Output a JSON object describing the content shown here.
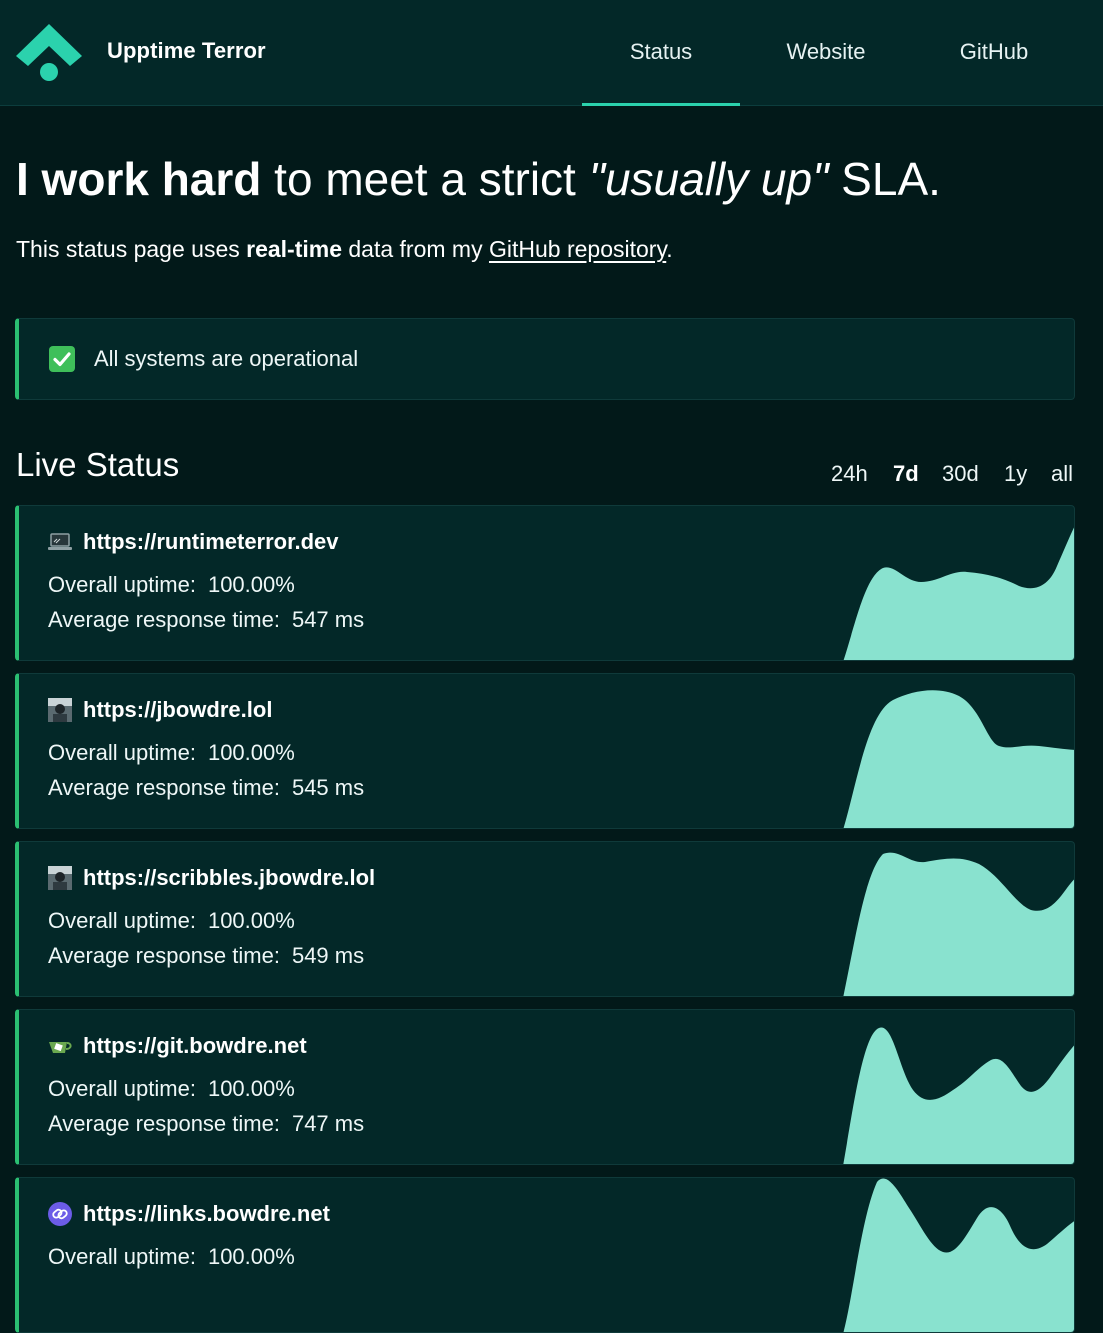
{
  "header": {
    "brand": "Upptime Terror",
    "nav": [
      {
        "label": "Status",
        "active": true
      },
      {
        "label": "Website",
        "active": false
      },
      {
        "label": "GitHub",
        "active": false
      }
    ]
  },
  "hero": {
    "title_bold": "I work hard",
    "title_mid": " to meet a strict ",
    "title_italic": "\"usually up\"",
    "title_end": " SLA.",
    "sub_pre": "This status page uses ",
    "sub_bold": "real-time",
    "sub_mid": " data from my ",
    "sub_link": "GitHub repository",
    "sub_end": "."
  },
  "banner": {
    "icon": "check-mark-icon",
    "text": "All systems are operational"
  },
  "live_status": {
    "title": "Live Status",
    "ranges": [
      {
        "label": "24h",
        "active": false
      },
      {
        "label": "7d",
        "active": true
      },
      {
        "label": "30d",
        "active": false
      },
      {
        "label": "1y",
        "active": false
      },
      {
        "label": "all",
        "active": false
      }
    ]
  },
  "labels": {
    "uptime": "Overall uptime:",
    "response": "Average response time:"
  },
  "colors": {
    "accent": "#2bd2ad",
    "chart_fill": "#89e2cf",
    "card_bg": "#032828",
    "status_ok": "#2bbf72"
  },
  "sites": [
    {
      "url": "https://runtimeterror.dev",
      "icon": "laptop-icon",
      "uptime": "100.00%",
      "response": "547 ms"
    },
    {
      "url": "https://jbowdre.lol",
      "icon": "avatar-icon",
      "uptime": "100.00%",
      "response": "545 ms"
    },
    {
      "url": "https://scribbles.jbowdre.lol",
      "icon": "avatar-icon",
      "uptime": "100.00%",
      "response": "549 ms"
    },
    {
      "url": "https://git.bowdre.net",
      "icon": "teacup-icon",
      "uptime": "100.00%",
      "response": "747 ms"
    },
    {
      "url": "https://links.bowdre.net",
      "icon": "link-icon",
      "uptime": "100.00%",
      "response": ""
    }
  ]
}
